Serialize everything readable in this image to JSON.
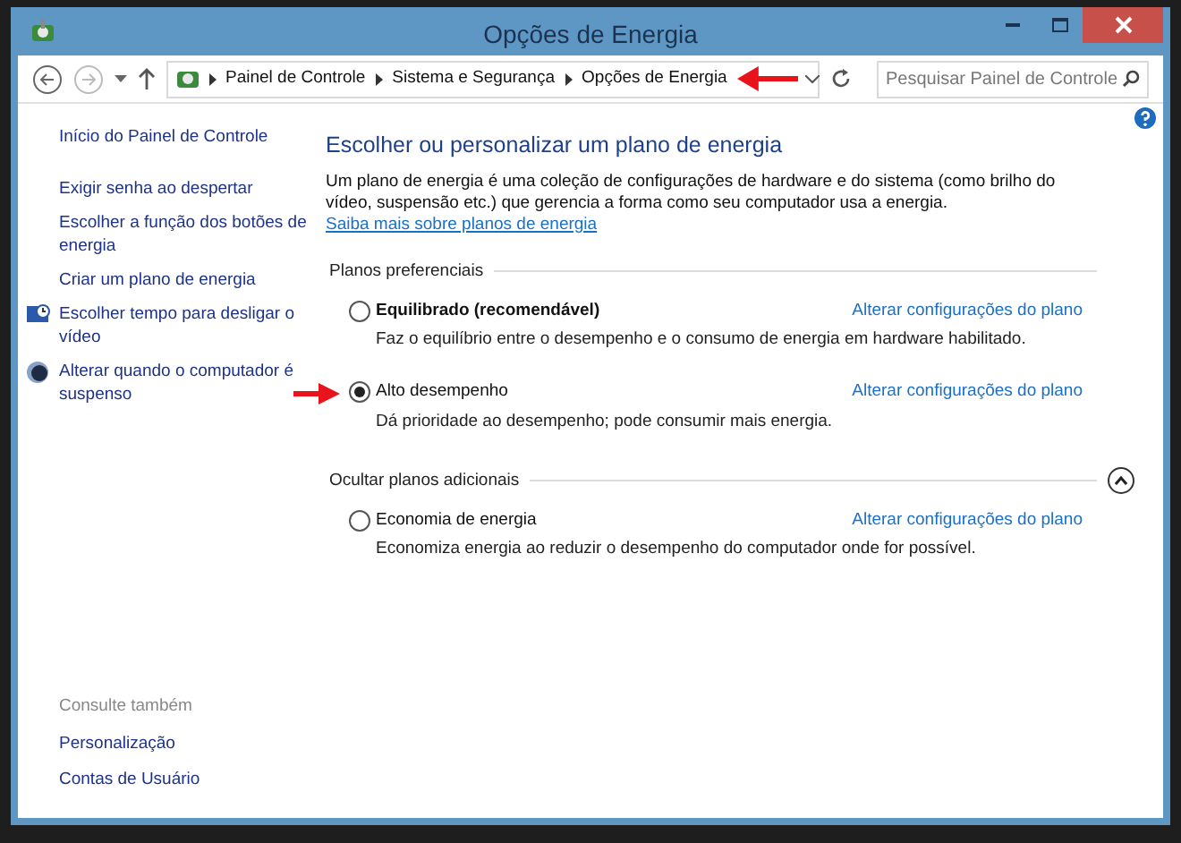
{
  "window": {
    "title": "Opções de Energia"
  },
  "address_bar": {
    "breadcrumbs": [
      "Painel de Controle",
      "Sistema e Segurança",
      "Opções de Energia"
    ]
  },
  "search": {
    "placeholder": "Pesquisar Painel de Controle"
  },
  "sidebar": {
    "home": "Início do Painel de Controle",
    "items": [
      {
        "label": "Exigir senha ao despertar",
        "kind": "plain"
      },
      {
        "label": "Escolher a função dos botões de energia",
        "kind": "plain"
      },
      {
        "label": "Criar um plano de energia",
        "kind": "plain"
      },
      {
        "label": "Escolher tempo para desligar o vídeo",
        "kind": "monitor"
      },
      {
        "label": "Alterar quando o computador é suspenso",
        "kind": "moon"
      }
    ],
    "see_also": {
      "title": "Consulte também",
      "links": [
        "Personalização",
        "Contas de Usuário"
      ]
    }
  },
  "main": {
    "heading": "Escolher ou personalizar um plano de energia",
    "intro": "Um plano de energia é uma coleção de configurações de hardware e do sistema (como brilho do vídeo, suspensão etc.) que gerencia a forma como seu computador usa a energia. ",
    "intro_link": "Saiba mais sobre planos de energia",
    "groups": [
      {
        "title": "Planos preferenciais",
        "plans": [
          {
            "name": "Equilibrado (recomendável)",
            "bold": true,
            "selected": false,
            "link": "Alterar configurações do plano",
            "description": "Faz o equilíbrio entre o desempenho e o consumo de energia em hardware habilitado."
          },
          {
            "name": "Alto desempenho",
            "bold": false,
            "selected": true,
            "link": "Alterar configurações do plano",
            "description": "Dá prioridade ao desempenho; pode consumir mais energia."
          }
        ]
      },
      {
        "title": "Ocultar planos adicionais",
        "expanded": true,
        "plans": [
          {
            "name": "Economia de energia",
            "bold": false,
            "selected": false,
            "link": "Alterar configurações do plano",
            "description": "Economiza energia ao reduzir o desempenho do computador onde for possível."
          }
        ]
      }
    ]
  }
}
